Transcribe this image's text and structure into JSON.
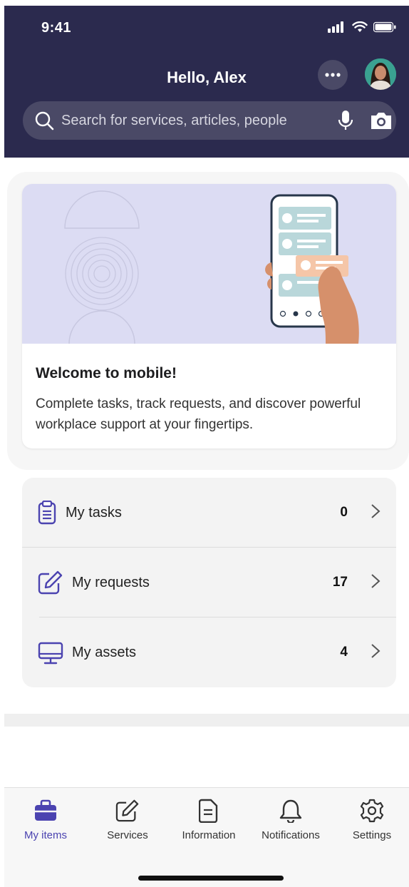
{
  "status_bar": {
    "time": "9:41"
  },
  "header": {
    "greeting": "Hello, Alex",
    "search_placeholder": "Search for services, articles, people"
  },
  "welcome": {
    "title": "Welcome to mobile!",
    "text": "Complete tasks, track requests, and discover powerful workplace support at your fingertips."
  },
  "items": [
    {
      "label": "My tasks",
      "count": "0",
      "icon": "clipboard-icon"
    },
    {
      "label": "My requests",
      "count": "17",
      "icon": "edit-icon"
    },
    {
      "label": "My assets",
      "count": "4",
      "icon": "monitor-icon"
    }
  ],
  "tabs": [
    {
      "label": "My items",
      "icon": "briefcase-icon",
      "active": true
    },
    {
      "label": "Services",
      "icon": "edit-icon",
      "active": false
    },
    {
      "label": "Information",
      "icon": "document-icon",
      "active": false
    },
    {
      "label": "Notifications",
      "icon": "bell-icon",
      "active": false
    },
    {
      "label": "Settings",
      "icon": "gear-icon",
      "active": false
    }
  ],
  "colors": {
    "header_bg": "#2b2a4e",
    "accent": "#4b43b0",
    "illustration_bg": "#dcdcf3"
  }
}
